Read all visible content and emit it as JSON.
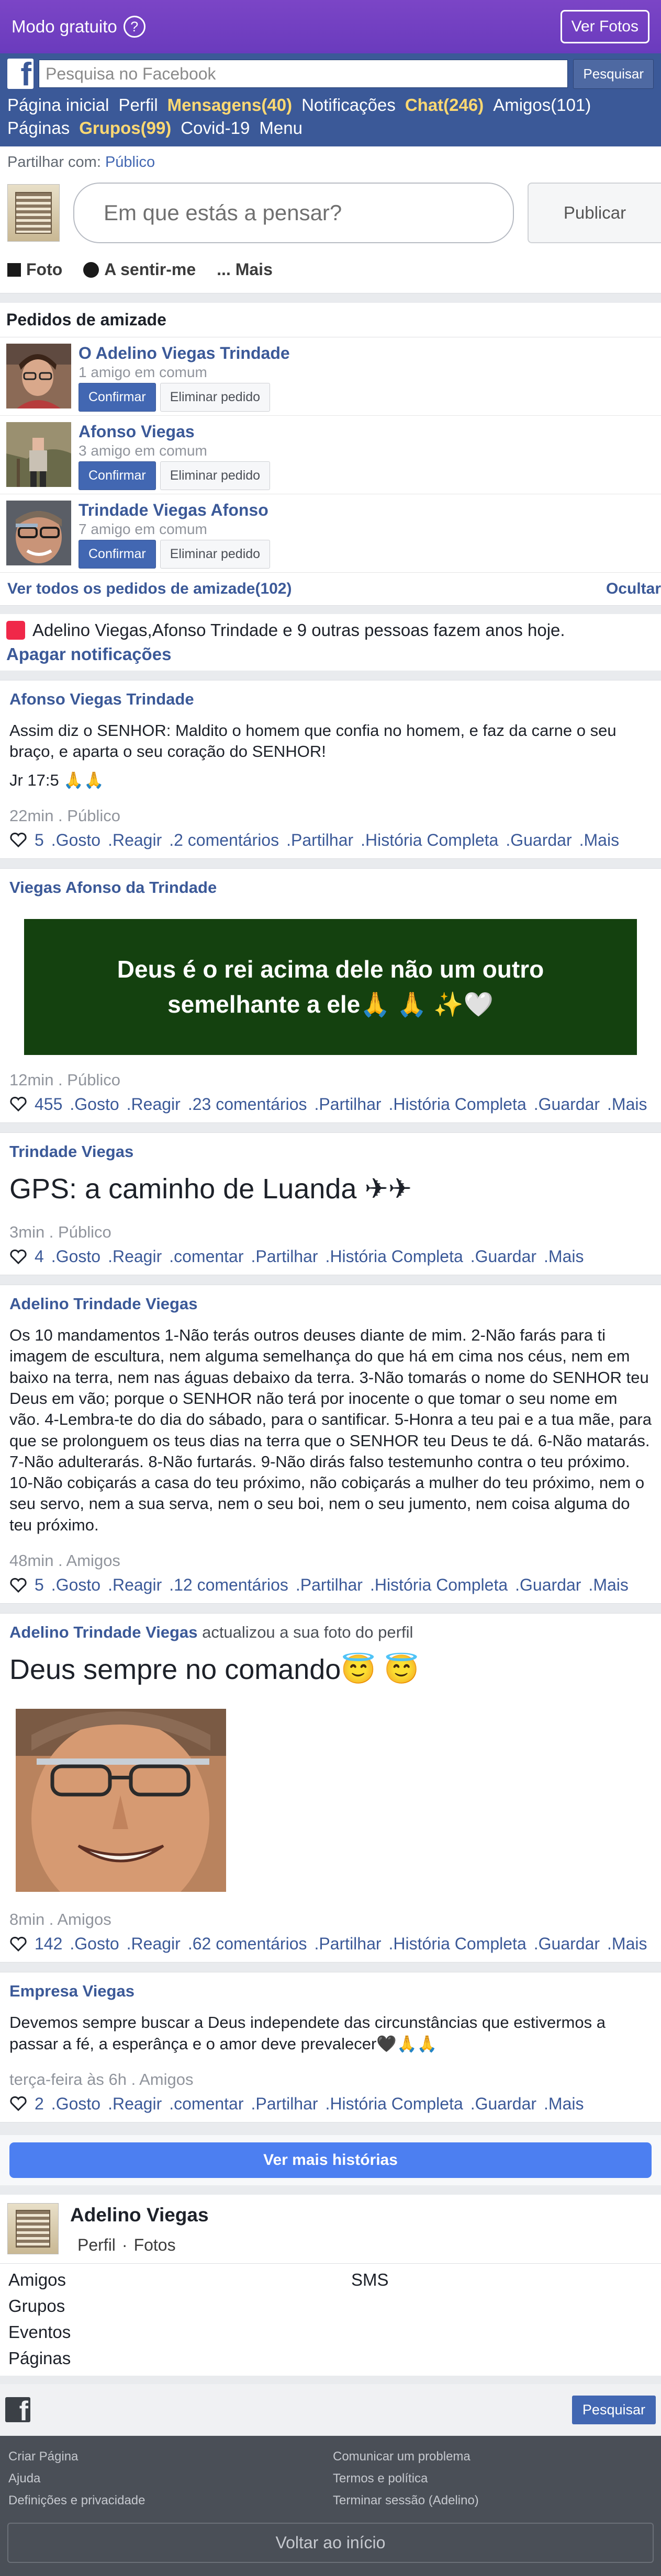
{
  "freebar": {
    "label": "Modo gratuito",
    "help": "?",
    "photos_button": "Ver Fotos"
  },
  "header": {
    "search_placeholder": "Pesquisa no Facebook",
    "search_button": "Pesquisar",
    "nav": [
      {
        "label": "Página inicial",
        "highlight": false
      },
      {
        "label": "Perfil",
        "highlight": false
      },
      {
        "label": "Mensagens(40)",
        "highlight": true
      },
      {
        "label": "Notificações",
        "highlight": false
      },
      {
        "label": "Chat(246)",
        "highlight": true
      },
      {
        "label": "Amigos(101)",
        "highlight": false
      },
      {
        "label": "Páginas",
        "highlight": false
      },
      {
        "label": "Grupos(99)",
        "highlight": true
      },
      {
        "label": "Covid-19",
        "highlight": false
      },
      {
        "label": "Menu",
        "highlight": false
      }
    ]
  },
  "composer": {
    "share_prefix": "Partilhar com:",
    "share_audience": "Público",
    "placeholder": "Em que estás a pensar?",
    "publish": "Publicar",
    "actions": {
      "photo": "Foto",
      "feeling": "A sentir-me",
      "more": "... Mais"
    }
  },
  "friend_requests": {
    "title": "Pedidos de amizade",
    "confirm": "Confirmar",
    "delete": "Eliminar pedido",
    "items": [
      {
        "name": "O Adelino Viegas Trindade",
        "mutual": "1 amigo em comum"
      },
      {
        "name": "Afonso Viegas",
        "mutual": "3 amigo em comum"
      },
      {
        "name": "Trindade Viegas Afonso",
        "mutual": "7 amigo em comum"
      }
    ],
    "see_all": "Ver todos os pedidos de amizade(102)",
    "hide": "Ocultar"
  },
  "birthdays": {
    "text": "Adelino Viegas,Afonso Trindade e 9 outras pessoas fazem anos hoje.",
    "clear": "Apagar notificações"
  },
  "stories": [
    {
      "author": "Afonso Viegas Trindade",
      "text": "Assim diz o SENHOR: Maldito o homem que confia no homem, e faz da carne o seu braço, e aparta o seu coração do SENHOR!",
      "text2": "Jr 17:5 🙏🙏",
      "meta": "22min . Público",
      "count": "5",
      "links": [
        ".Gosto",
        ".Reagir",
        ".2 comentários",
        ".Partilhar",
        ".História Completa",
        ".Guardar",
        ".Mais"
      ]
    },
    {
      "author": "Viegas Afonso da Trindade",
      "banner": "Deus é o rei acima dele não um outro semelhante a ele🙏 🙏 ✨🤍",
      "meta": "12min . Público",
      "count": "455",
      "links": [
        ".Gosto",
        ".Reagir",
        ".23 comentários",
        ".Partilhar",
        ".História Completa",
        ".Guardar",
        ".Mais"
      ]
    },
    {
      "author": "Trindade Viegas",
      "text": "GPS: a caminho de Luanda ✈✈",
      "meta": "3min . Público",
      "count": "4",
      "links": [
        ".Gosto",
        ".Reagir",
        ".comentar",
        ".Partilhar",
        ".História Completa",
        ".Guardar",
        ".Mais"
      ]
    },
    {
      "author": "Adelino Trindade Viegas",
      "text": "Os 10 mandamentos 1-Não terás outros deuses diante de mim. 2-Não farás para ti imagem de escultura, nem alguma semelhança do que há em cima nos céus, nem em baixo na terra, nem nas águas debaixo da terra. 3-Não tomarás o nome do SENHOR teu Deus em vão; porque o SENHOR não terá por inocente o que tomar o seu nome em vão. 4-Lembra-te do dia do sábado, para o santificar. 5-Honra a teu pai e a tua mãe, para que se prolonguem os teus dias na terra que o SENHOR teu Deus te dá. 6-Não matarás. 7-Não adulterarás. 8-Não furtarás. 9-Não dirás falso testemunho contra o teu próximo. 10-Não cobiçarás a casa do teu próximo, não cobiçarás a mulher do teu próximo, nem o seu servo, nem a sua serva, nem o seu boi, nem o seu jumento, nem coisa alguma do teu próximo.",
      "meta": "48min . Amigos",
      "count": "5",
      "links": [
        ".Gosto",
        ".Reagir",
        ".12 comentários",
        ".Partilhar",
        ".História Completa",
        ".Guardar",
        ".Mais"
      ]
    },
    {
      "author": "Adelino Trindade Viegas",
      "author_suffix": " actualizou a sua foto do perfil",
      "text": "Deus sempre no comando😇 😇",
      "meta": "8min . Amigos",
      "count": "142",
      "links": [
        ".Gosto",
        ".Reagir",
        ".62 comentários",
        ".Partilhar",
        ".História Completa",
        ".Guardar",
        ".Mais"
      ]
    },
    {
      "author": "Empresa Viegas",
      "text": "Devemos sempre buscar a Deus independete das circunstâncias que estivermos a passar a fé, a esperânça e o amor deve prevalecer🖤🙏🙏",
      "meta": "terça-feira às 6h . Amigos",
      "count": "2",
      "links": [
        ".Gosto",
        ".Reagir",
        ".comentar",
        ".Partilhar",
        ".História Completa",
        ".Guardar",
        ".Mais"
      ]
    }
  ],
  "more_stories": "Ver mais histórias",
  "profile": {
    "name": "Adelino Viegas",
    "profile_link": "Perfil",
    "sep": "·",
    "photos_link": "Fotos"
  },
  "quick_links": [
    "Amigos",
    "SMS",
    "Grupos",
    "",
    "Eventos",
    "",
    "Páginas",
    ""
  ],
  "footer": {
    "search": "Pesquisar",
    "links": [
      "Criar Página",
      "Comunicar um problema",
      "Ajuda",
      "Termos e política",
      "Definições e privacidade",
      "Terminar sessão (Adelino)"
    ],
    "back_to_top": "Voltar ao início"
  },
  "colors": {
    "brand": "#3b5998",
    "free_mode": "#7b45c6",
    "highlight": "#fcd872",
    "banner": "#14410f"
  }
}
